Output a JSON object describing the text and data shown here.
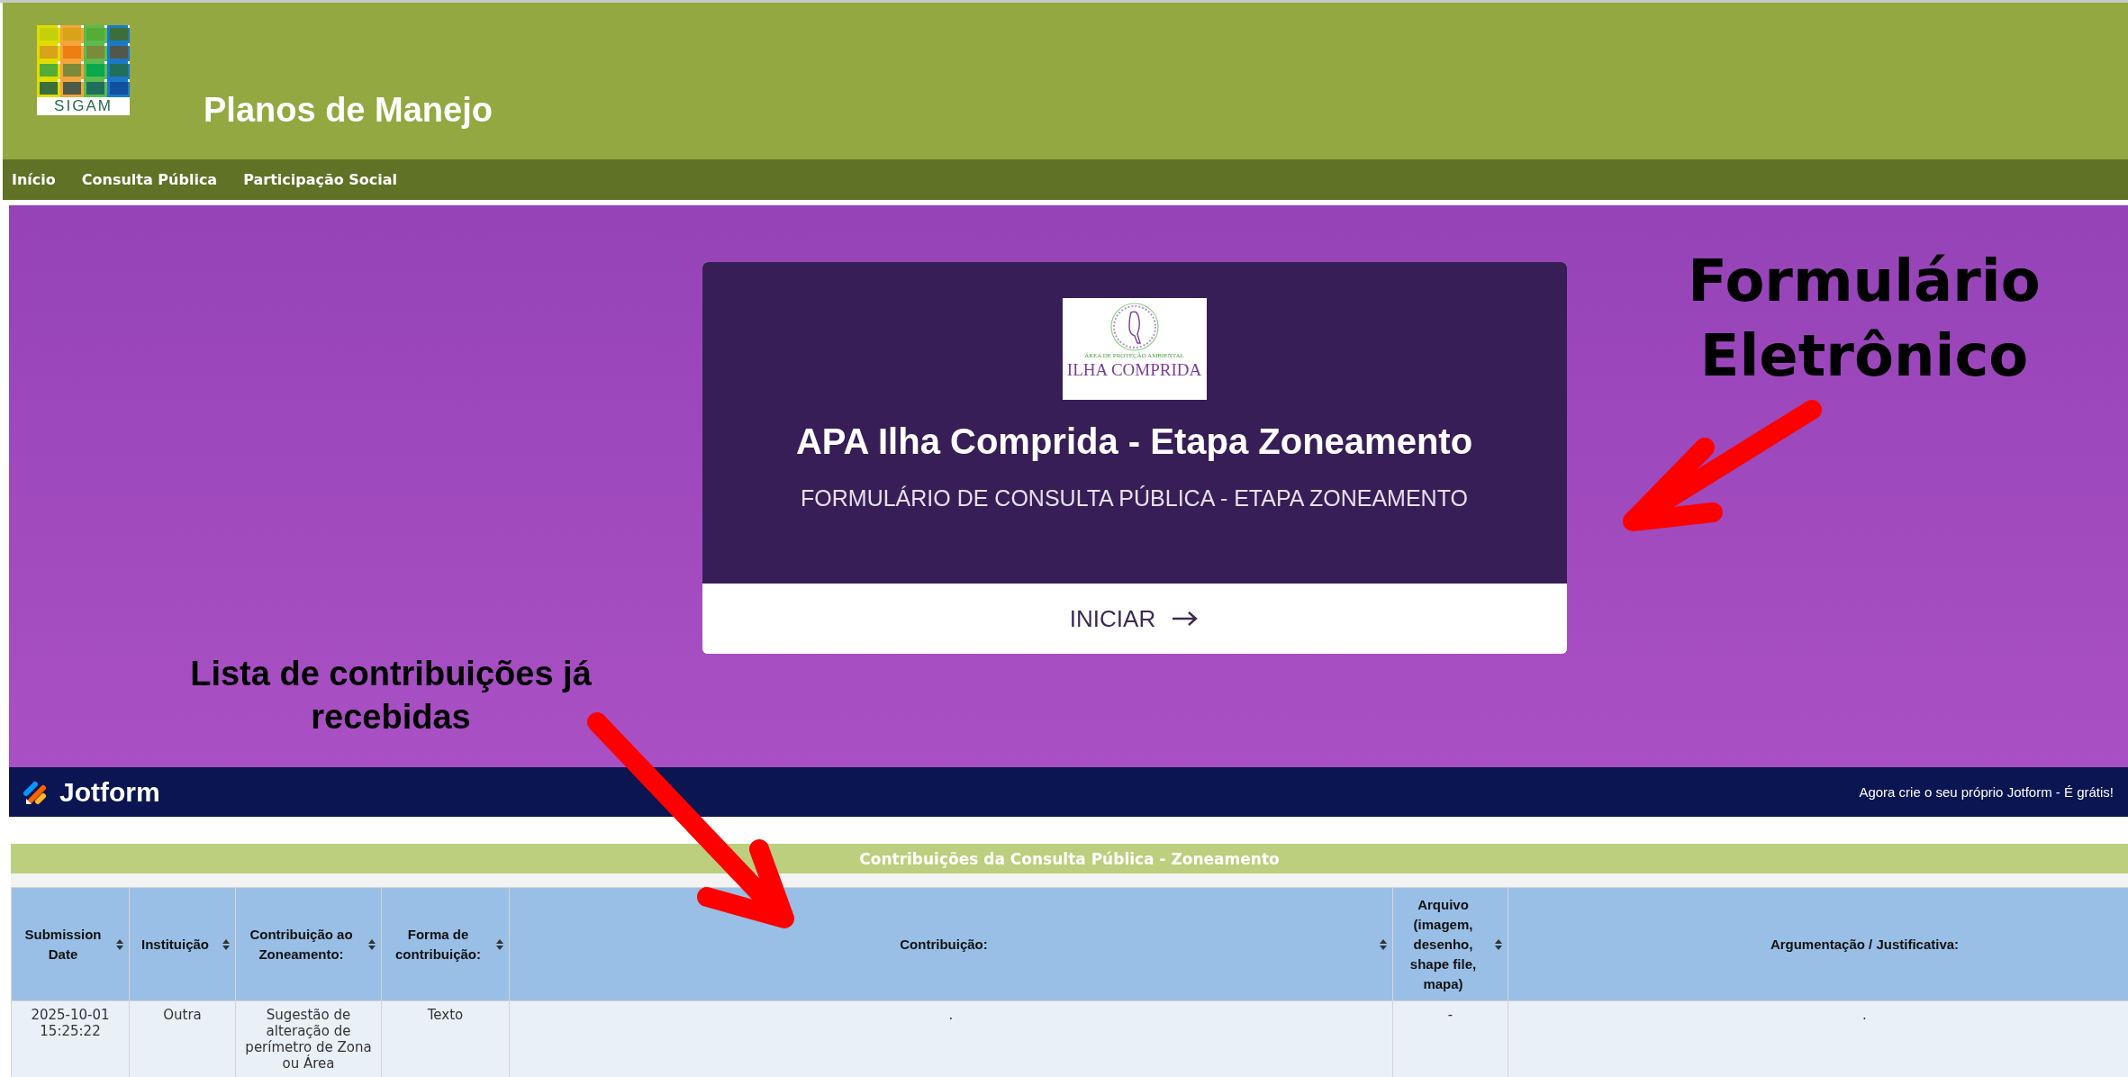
{
  "header": {
    "logo_text": "SIGAM",
    "title": "Planos de Manejo"
  },
  "nav": [
    {
      "label": "Início"
    },
    {
      "label": "Consulta Pública"
    },
    {
      "label": "Participação Social"
    }
  ],
  "form_card": {
    "logo": {
      "caption_small": "ÁREA DE PROTEÇÃO AMBIENTAL",
      "caption": "ILHA COMPRIDA"
    },
    "title": "APA Ilha Comprida - Etapa Zoneamento",
    "subtitle": "FORMULÁRIO DE CONSULTA PÚBLICA - ETAPA ZONEAMENTO",
    "button": "INICIAR"
  },
  "jotform_bar": {
    "brand": "Jotform",
    "promo": "Agora crie o seu próprio Jotform - É grátis!"
  },
  "table": {
    "title": "Contribuições da Consulta Pública - Zoneamento",
    "columns": [
      {
        "label": "Submission Date",
        "sortable": true
      },
      {
        "label": "Instituição",
        "sortable": true
      },
      {
        "label": "Contribuição ao Zoneamento:",
        "sortable": true
      },
      {
        "label": "Forma de contribuição:",
        "sortable": true
      },
      {
        "label": "Contribuição:",
        "sortable": true
      },
      {
        "label": "Arquivo (imagem, desenho, shape file, mapa)",
        "sortable": true
      },
      {
        "label": "Argumentação / Justificativa:",
        "sortable": false
      }
    ],
    "rows": [
      [
        "2025-10-01 15:25:22",
        "Outra",
        "Sugestão de alteração de perímetro de Zona ou Área",
        "Texto",
        ".",
        "-",
        "."
      ]
    ]
  },
  "annotations": [
    {
      "text": "Formulário Eletrônico"
    },
    {
      "text": "Lista de contribuições já recebidas"
    }
  ]
}
